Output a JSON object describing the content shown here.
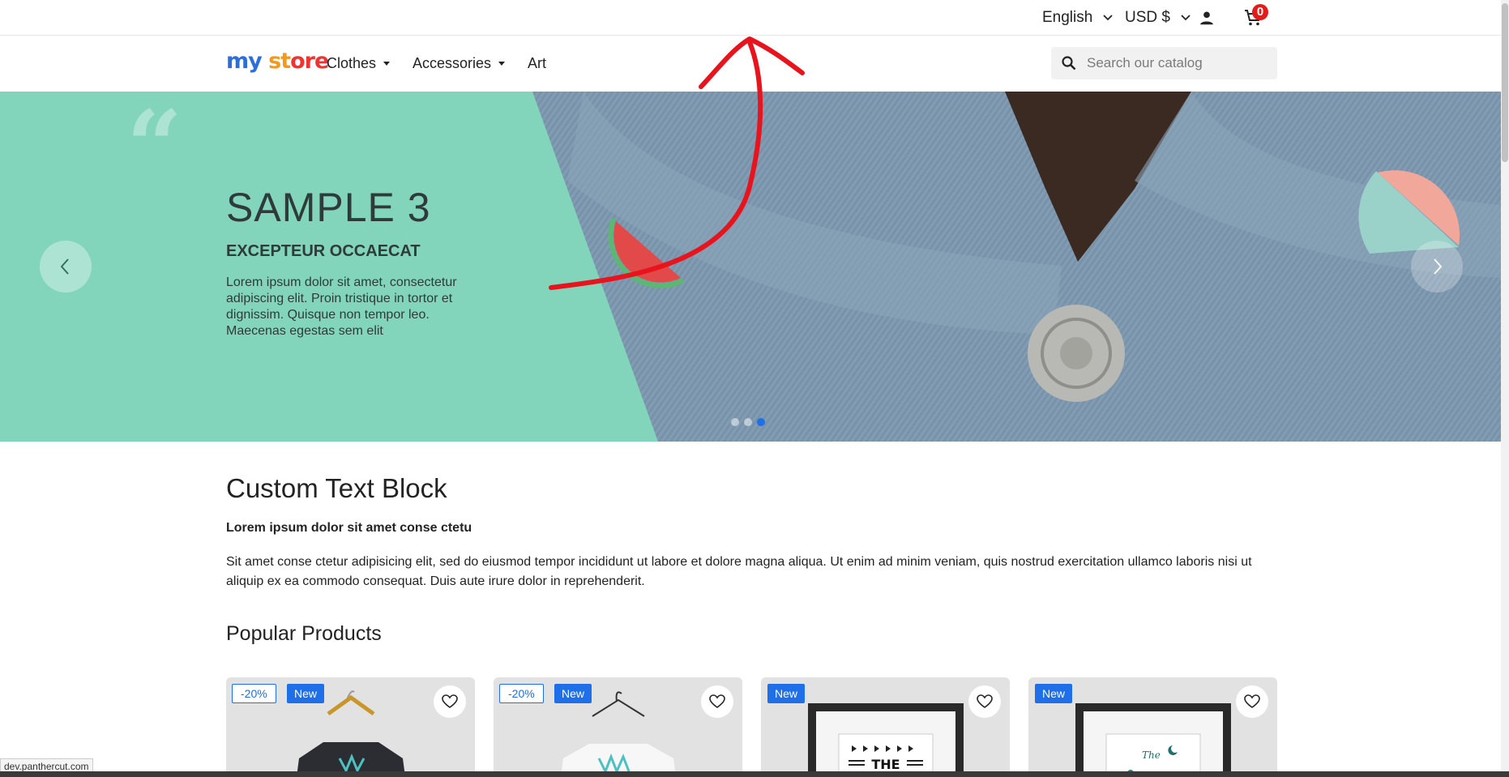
{
  "topbar": {
    "language": "English",
    "currency": "USD $",
    "cart_count": "0",
    "icons": [
      "chevron-down-icon",
      "user-icon",
      "cart-icon"
    ]
  },
  "header": {
    "logo": {
      "part1": "my",
      "part2": " ",
      "part3": "st",
      "part4": "ore"
    },
    "nav": [
      {
        "label": "Clothes",
        "has_dropdown": true
      },
      {
        "label": "Accessories",
        "has_dropdown": true
      },
      {
        "label": "Art",
        "has_dropdown": false
      }
    ],
    "search_placeholder": "Search our catalog"
  },
  "hero": {
    "title": "SAMPLE 3",
    "subtitle": "EXCEPTEUR OCCAECAT",
    "text": "Lorem ipsum dolor sit amet, consectetur adipiscing elit. Proin tristique in tortor et dignissim. Quisque non tempor leo. Maecenas egestas sem elit",
    "slide_count": 3,
    "active_slide": 3,
    "accent_color": "#82d5bb"
  },
  "custom_text_block": {
    "title": "Custom Text Block",
    "subtitle": "Lorem ipsum dolor sit amet conse ctetu",
    "body": "Sit amet conse ctetur adipisicing elit, sed do eiusmod tempor incididunt ut labore et dolore magna aliqua. Ut enim ad minim veniam, quis nostrud exercitation ullamco laboris nisi ut aliquip ex ea commodo consequat. Duis aute irure dolor in reprehenderit."
  },
  "popular_products": {
    "title": "Popular Products",
    "products": [
      {
        "discount": "-20%",
        "flag": "New",
        "image": "dark-tshirt"
      },
      {
        "discount": "-20%",
        "flag": "New",
        "image": "white-tshirt"
      },
      {
        "discount": "",
        "flag": "New",
        "image": "framed-poster-the"
      },
      {
        "discount": "",
        "flag": "New",
        "image": "framed-poster-script"
      }
    ]
  },
  "status_bar": {
    "url": "dev.panthercut.com"
  },
  "colors": {
    "primary": "#1e6fe8",
    "badge_red": "#e41b1b",
    "annotation_red": "#e8141d"
  }
}
